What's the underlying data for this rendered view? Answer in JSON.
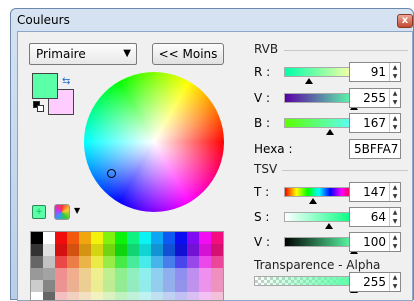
{
  "window": {
    "title": "Couleurs",
    "close_label": "x"
  },
  "left": {
    "mode_dropdown": "Primaire",
    "less_button": "<< Moins",
    "primary_color": "#5bffa7",
    "secondary_color": "#ffccff"
  },
  "rgb": {
    "section": "RVB",
    "rows": [
      {
        "label": "R :",
        "value": "91",
        "level": 0.357
      },
      {
        "label": "V :",
        "value": "255",
        "level": 1.0
      },
      {
        "label": "B :",
        "value": "167",
        "level": 0.655
      }
    ],
    "hex_label": "Hexa :",
    "hex_value": "5BFFA7"
  },
  "hsv": {
    "section": "TSV",
    "rows": [
      {
        "label": "T :",
        "value": "147",
        "level": 0.408
      },
      {
        "label": "S :",
        "value": "64",
        "level": 0.64
      },
      {
        "label": "V :",
        "value": "100",
        "level": 1.0
      }
    ]
  },
  "alpha": {
    "section": "Transparence - Alpha",
    "value": "255",
    "level": 1.0
  },
  "icons": [
    "swap-icon",
    "reset-colors-icon",
    "add-to-palette-icon",
    "palette-menu-icon",
    "close-icon"
  ]
}
